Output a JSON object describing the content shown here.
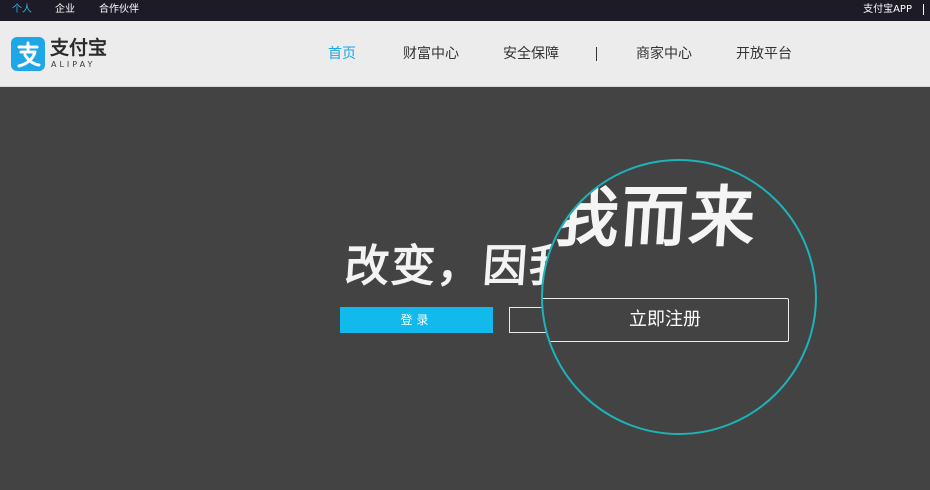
{
  "topbar": {
    "links": [
      "个人",
      "企业",
      "合作伙伴"
    ],
    "app_link": "支付宝APP"
  },
  "header": {
    "logo_cn": "支付宝",
    "logo_en": "ALIPAY",
    "nav": [
      "首页",
      "财富中心",
      "安全保障",
      "商家中心",
      "开放平台"
    ]
  },
  "hero": {
    "slogan": "改变，因我而来",
    "slogan_visible": "改变，因我",
    "slogan_magnified": "我而来",
    "login_label": "登录",
    "register_label": "立即注册"
  },
  "colors": {
    "accent": "#1ea6e6",
    "login_button": "#11b9ec",
    "magnifier_ring": "#1db3b8",
    "hero_bg": "#434343",
    "topbar_bg": "#1c1b26"
  }
}
